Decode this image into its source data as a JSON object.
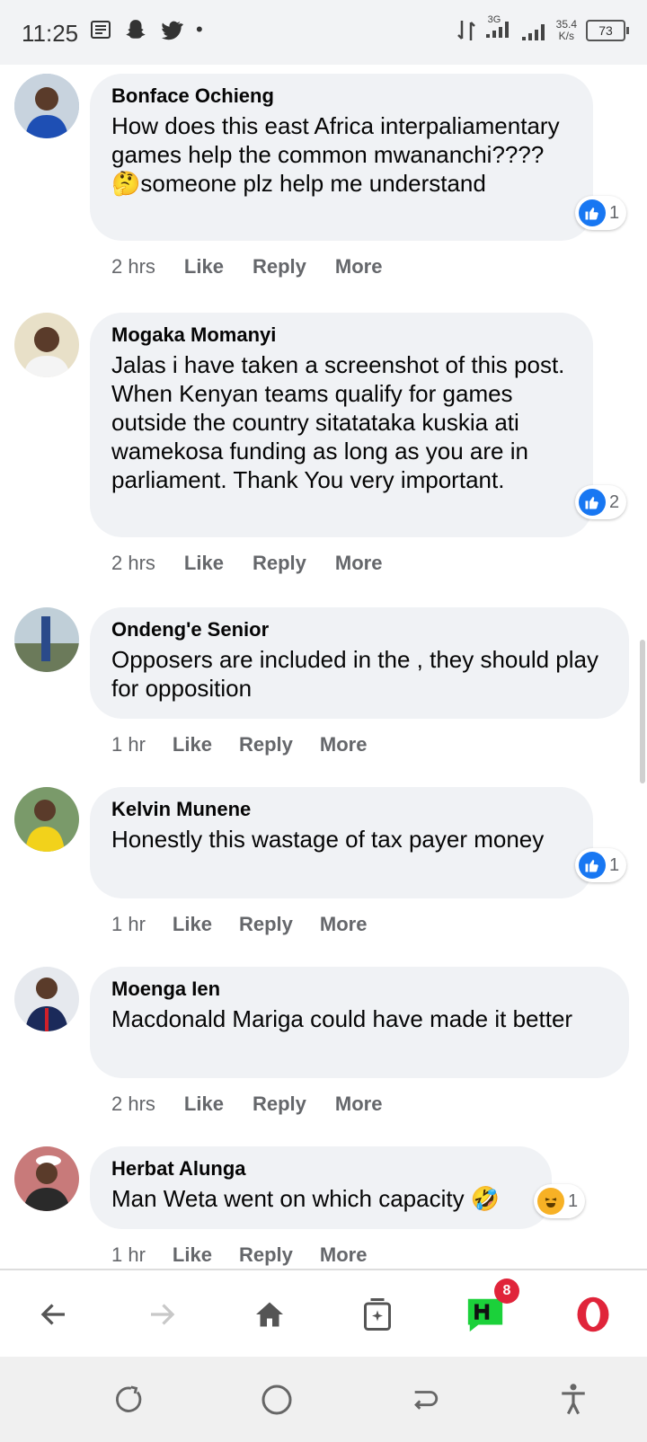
{
  "status_bar": {
    "time": "11:25",
    "network": "3G",
    "speed_value": "35.4",
    "speed_unit": "K/s",
    "battery": "73"
  },
  "actions": {
    "like": "Like",
    "reply": "Reply",
    "more": "More"
  },
  "comments": [
    {
      "author": "Bonface Ochieng",
      "text": "How does this east Africa interpaliamentary games help the common mwananchi????🤔someone plz help me understand",
      "time": "2 hrs",
      "reaction": "like",
      "reaction_count": "1"
    },
    {
      "author": "Mogaka Momanyi",
      "text": "Jalas i have taken a screenshot of this post. When Kenyan teams qualify for games outside the country sitatataka kuskia ati wamekosa funding as long as you are in parliament. Thank You very important.",
      "time": "2 hrs",
      "reaction": "like",
      "reaction_count": "2"
    },
    {
      "author": "Ondeng'e Senior",
      "text": "Opposers are included in the , they should play for opposition",
      "time": "1 hr",
      "reaction": "",
      "reaction_count": ""
    },
    {
      "author": "Kelvin Munene",
      "text": "Honestly this wastage of tax payer money",
      "time": "1 hr",
      "reaction": "like",
      "reaction_count": "1"
    },
    {
      "author": "Moenga Ien",
      "text": "Macdonald Mariga could have made it better",
      "time": "2 hrs",
      "reaction": "",
      "reaction_count": ""
    },
    {
      "author": "Herbat Alunga",
      "text": "Man Weta went on which capacity 🤣",
      "time": "1 hr",
      "reaction": "haha",
      "reaction_count": "1"
    }
  ],
  "bottom_nav": {
    "badge_count": "8"
  },
  "colors": {
    "like_blue": "#1877f2",
    "badge_red": "#e0243a",
    "opera_red": "#e0243a"
  }
}
